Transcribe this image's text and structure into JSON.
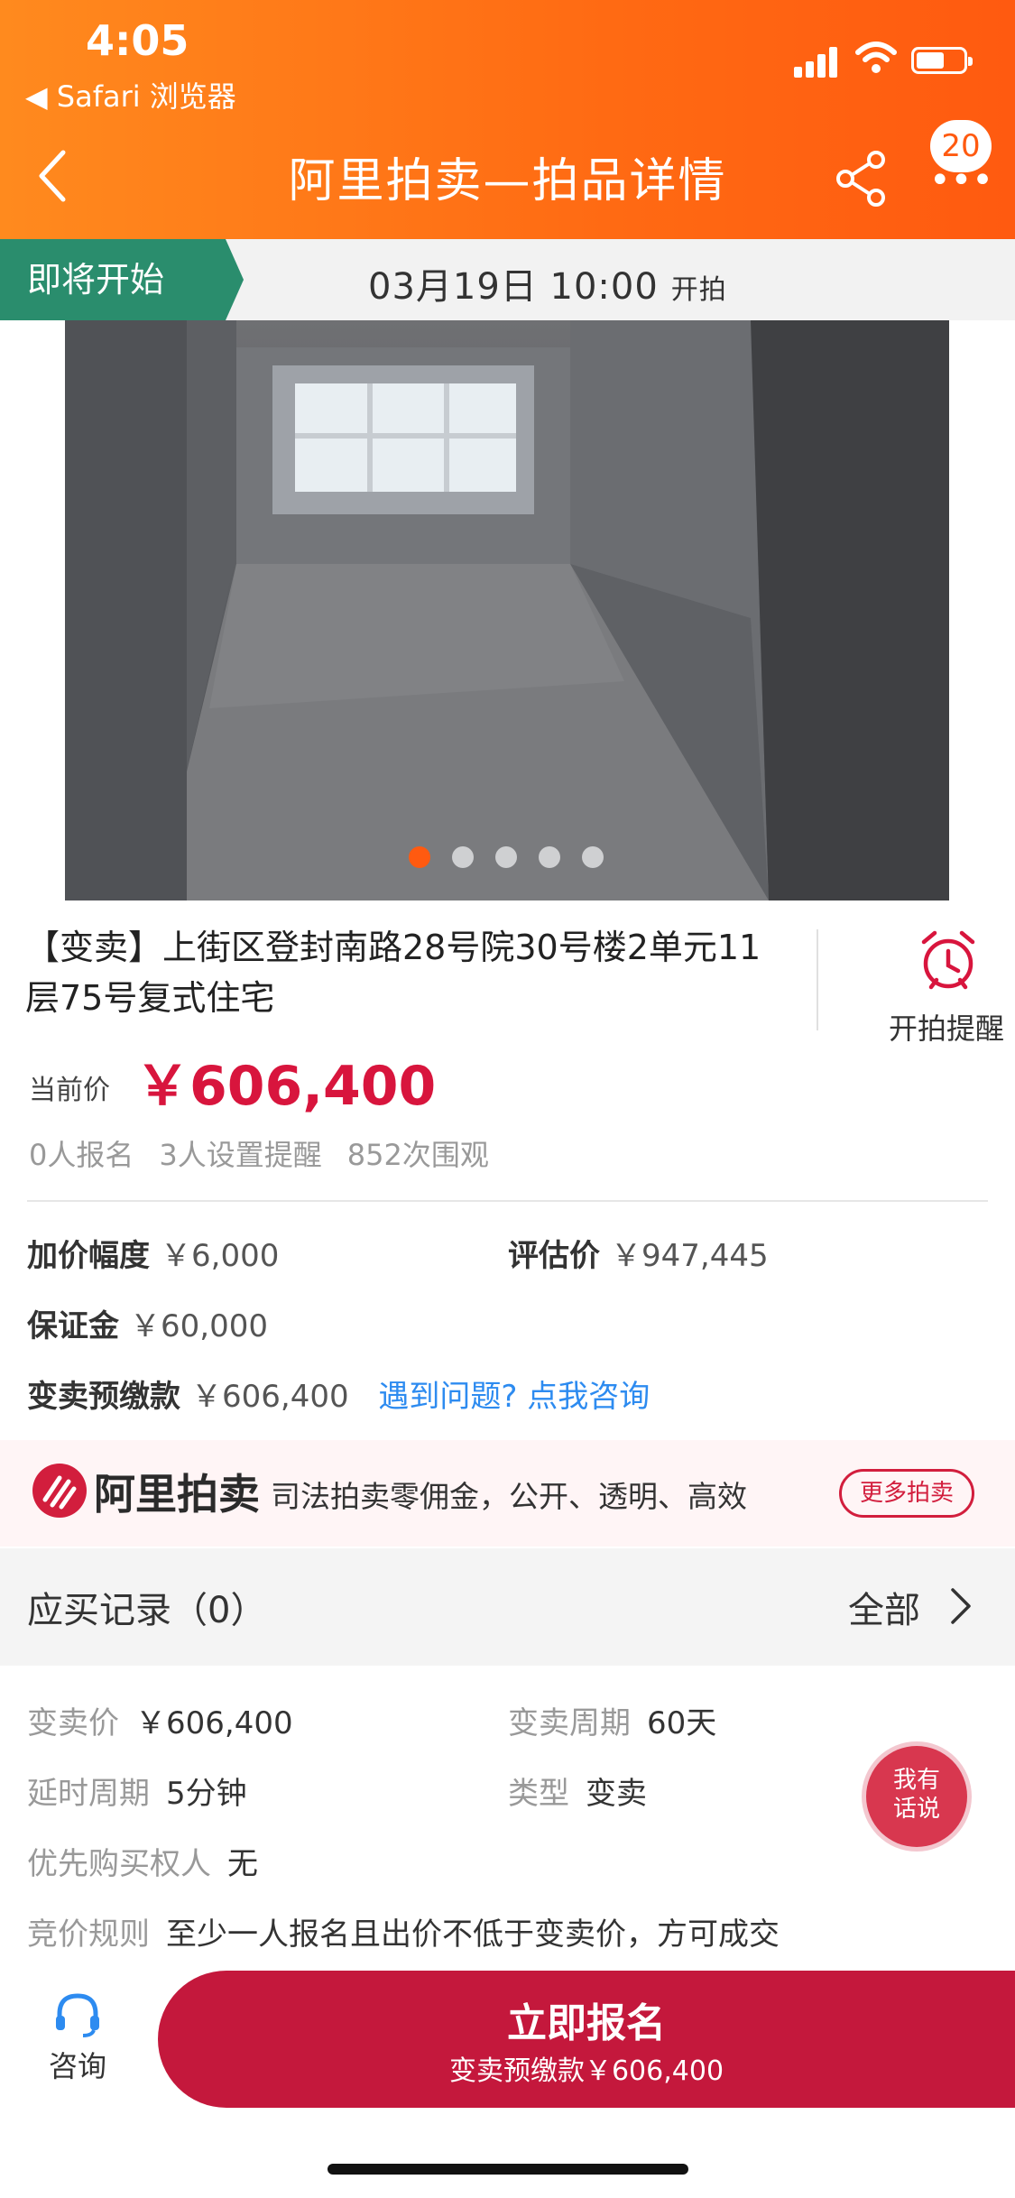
{
  "status_bar": {
    "time": "4:05",
    "back_app": "◀ Safari 浏览器"
  },
  "nav": {
    "title": "阿里拍卖—拍品详情",
    "badge_count": "20"
  },
  "auction_band": {
    "tag": "即将开始",
    "time": "03月19日 10:00",
    "suffix": "开拍"
  },
  "gallery": {
    "slide_count": 5,
    "active_index": 0
  },
  "lot": {
    "title": "【变卖】上街区登封南路28号院30号楼2单元11层75号复式住宅",
    "reminder_label": "开拍提醒",
    "price_label": "当前价",
    "price": "￥606,400",
    "stats": [
      "0人报名",
      "3人设置提醒",
      "852次围观"
    ]
  },
  "fees": {
    "increment_label": "加价幅度",
    "increment": "￥6,000",
    "appraisal_label": "评估价",
    "appraisal": "￥947,445",
    "deposit_label": "保证金",
    "deposit": "￥60,000",
    "prepay_label": "变卖预缴款",
    "prepay": "￥606,400",
    "help_link": "遇到问题? 点我咨询"
  },
  "promo": {
    "brand": "阿里拍卖",
    "text": "司法拍卖零佣金，公开、透明、高效",
    "button": "更多拍卖"
  },
  "records": {
    "title": "应买记录（0）",
    "all_label": "全部"
  },
  "details": {
    "sale_price_label": "变卖价",
    "sale_price": "￥606,400",
    "cycle_label": "变卖周期",
    "cycle": "60天",
    "delay_label": "延时周期",
    "delay": "5分钟",
    "type_label": "类型",
    "type": "变卖",
    "priority_label": "优先购买权人",
    "priority": "无",
    "rule_label": "竞价规则",
    "rule": "至少一人报名且出价不低于变卖价，方可成交"
  },
  "float_button": {
    "line1": "我有",
    "line2": "话说"
  },
  "bottom": {
    "consult_label": "咨询",
    "cta_main": "立即报名",
    "cta_sub": "变卖预缴款￥606,400"
  },
  "colors": {
    "header_orange": "#ff6a13",
    "band_green": "#2a8d6d",
    "price_red": "#d8153d",
    "cta_red": "#c4183c",
    "link_blue": "#2d8bf0"
  }
}
